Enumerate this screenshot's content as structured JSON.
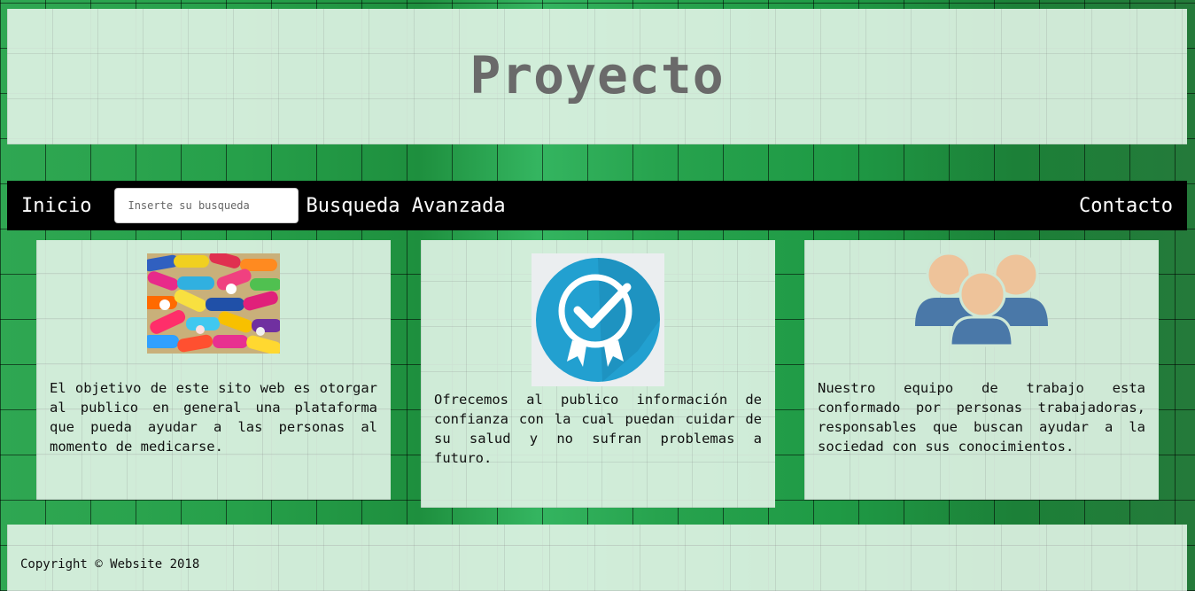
{
  "header": {
    "title": "Proyecto"
  },
  "nav": {
    "home": "Inicio",
    "search_placeholder": "Inserte su busqueda",
    "advanced_search": "Busqueda Avanzada",
    "contact": "Contacto"
  },
  "cards": [
    {
      "image": "colorful-pills-image",
      "text": "El objetivo de este sito web es otorgar al publico en general una plataforma que pueda ayudar a las personas al momento de medicarse."
    },
    {
      "image": "quality-badge-checkmark-icon",
      "text": "Ofrecemos al publico información de confianza con la cual puedan cuidar de su salud y no sufran problemas a futuro."
    },
    {
      "image": "team-people-icon",
      "text": "Nuestro equipo de trabajo esta conformado por personas trabajadoras, responsables que buscan ayudar a la sociedad con sus conocimientos."
    }
  ],
  "footer": {
    "copyright": "Copyright © Website 2018"
  },
  "colors": {
    "background": "#24a24c",
    "nav": "#000000",
    "panel": "#def2e4",
    "badge": "#22a0d0",
    "team": "#4a78a8",
    "skin": "#eec39a"
  }
}
